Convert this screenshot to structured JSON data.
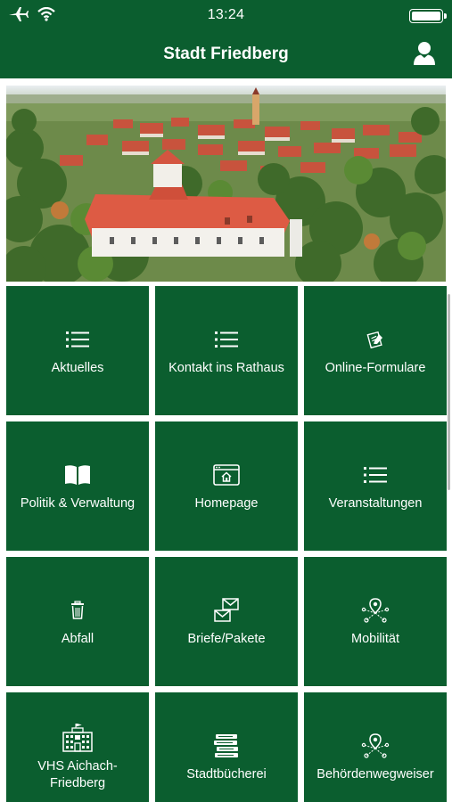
{
  "status": {
    "time": "13:24"
  },
  "nav": {
    "title": "Stadt Friedberg"
  },
  "hero": {
    "alt": "Luftaufnahme Friedberg"
  },
  "tiles": [
    {
      "label": "Aktuelles",
      "icon": "list-icon"
    },
    {
      "label": "Kontakt ins Rathaus",
      "icon": "list-icon"
    },
    {
      "label": "Online-Formulare",
      "icon": "form-icon"
    },
    {
      "label": "Politik & Verwaltung",
      "icon": "book-icon"
    },
    {
      "label": "Homepage",
      "icon": "browser-home-icon"
    },
    {
      "label": "Veranstaltungen",
      "icon": "list-icon"
    },
    {
      "label": "Abfall",
      "icon": "trash-icon"
    },
    {
      "label": "Briefe/Pakete",
      "icon": "mail-icon"
    },
    {
      "label": "Mobilität",
      "icon": "map-pin-network-icon"
    },
    {
      "label": "VHS Aichach-Friedberg",
      "icon": "building-icon"
    },
    {
      "label": "Stadtbücherei",
      "icon": "books-icon"
    },
    {
      "label": "Behördenwegweiser",
      "icon": "map-pin-network-icon"
    }
  ],
  "colors": {
    "brand": "#0b5e2f",
    "text": "#ffffff"
  }
}
